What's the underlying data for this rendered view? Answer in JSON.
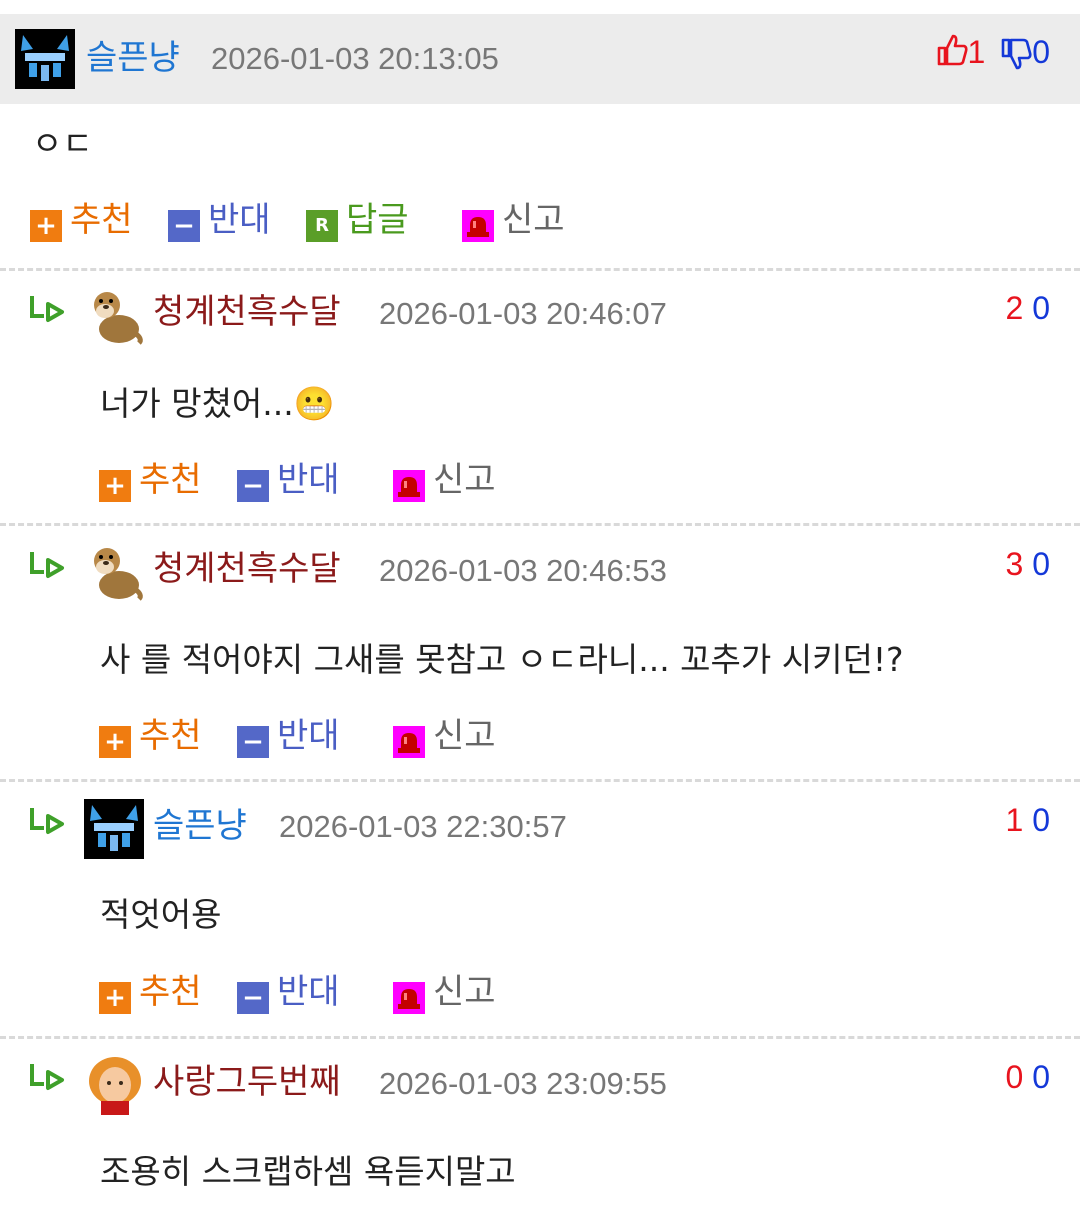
{
  "comments": [
    {
      "nickname": "슬픈냥",
      "datetime": "2026-01-03 20:13:05",
      "likes": "1",
      "dislikes": "0",
      "text": "ㅇㄷ",
      "actions": {
        "recommend": "추천",
        "oppose": "반대",
        "reply": "답글",
        "report": "신고"
      }
    },
    {
      "nickname": "청계천흑수달",
      "datetime": "2026-01-03 20:46:07",
      "likes": "2",
      "dislikes": "0",
      "text": "너가 망쳤어...😬",
      "actions": {
        "recommend": "추천",
        "oppose": "반대",
        "report": "신고"
      }
    },
    {
      "nickname": "청계천흑수달",
      "datetime": "2026-01-03 20:46:53",
      "likes": "3",
      "dislikes": "0",
      "text": "사 를 적어야지 그새를 못참고 ㅇㄷ라니... 꼬추가 시키던!?",
      "actions": {
        "recommend": "추천",
        "oppose": "반대",
        "report": "신고"
      }
    },
    {
      "nickname": "슬픈냥",
      "datetime": "2026-01-03 22:30:57",
      "likes": "1",
      "dislikes": "0",
      "text": "적엇어용",
      "actions": {
        "recommend": "추천",
        "oppose": "반대",
        "report": "신고"
      }
    },
    {
      "nickname": "사랑그두번째",
      "datetime": "2026-01-03 23:09:55",
      "likes": "0",
      "dislikes": "0",
      "text": "조용히 스크랩하셈 욕듣지말고"
    }
  ],
  "icons": {
    "plus": "+",
    "minus": "−",
    "reply": "R",
    "thumbs_up": "thumbs-up-icon",
    "thumbs_down": "thumbs-down-icon",
    "reply_arrow": "reply-arrow-icon",
    "report": "siren-icon"
  },
  "colors": {
    "nick_blue": "#1f76d2",
    "nick_red": "#8b1a1a",
    "recommend": "#f07c10",
    "oppose": "#5468c8",
    "reply": "#5a9e28",
    "report": "#ff00ff",
    "like_count": "#e8141e",
    "dislike_count": "#1438d8"
  }
}
